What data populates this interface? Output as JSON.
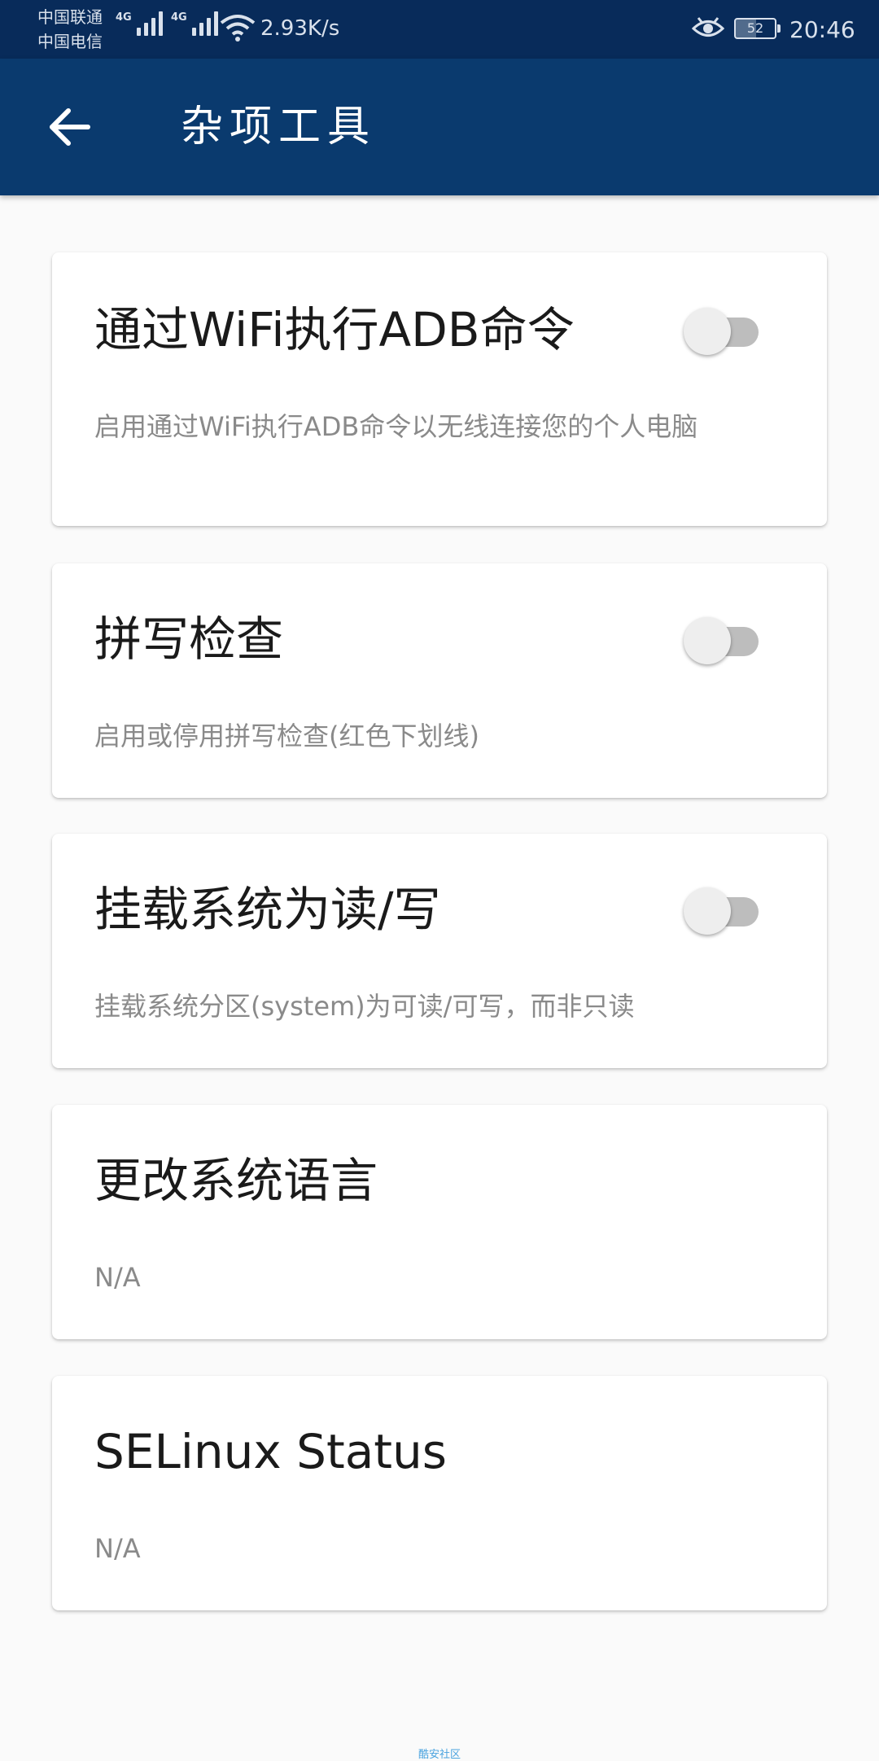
{
  "status_bar": {
    "carrier_1": "中国联通",
    "carrier_2": "中国电信",
    "network_1": "4G",
    "network_2": "4G",
    "speed": "2.93K/s",
    "battery": "52",
    "time": "20:46"
  },
  "app_bar": {
    "title": "杂项工具",
    "back_icon": "arrow-back-icon"
  },
  "settings": [
    {
      "title": "通过WiFi执行ADB命令",
      "description": "启用通过WiFi执行ADB命令以无线连接您的个人电脑",
      "toggle": false
    },
    {
      "title": "拼写检查",
      "description": "启用或停用拼写检查(红色下划线)",
      "toggle": false
    },
    {
      "title": "挂载系统为读/写",
      "description": "挂载系统分区(system)为可读/可写，而非只读",
      "toggle": false
    },
    {
      "title": "更改系统语言",
      "description": "N/A"
    },
    {
      "title": "SELinux Status",
      "description": "N/A"
    }
  ],
  "watermark": "酷安社区",
  "colors": {
    "status_bar": "#082b5a",
    "app_bar": "#0a3a6e",
    "background": "#fafafa",
    "card": "#ffffff"
  }
}
